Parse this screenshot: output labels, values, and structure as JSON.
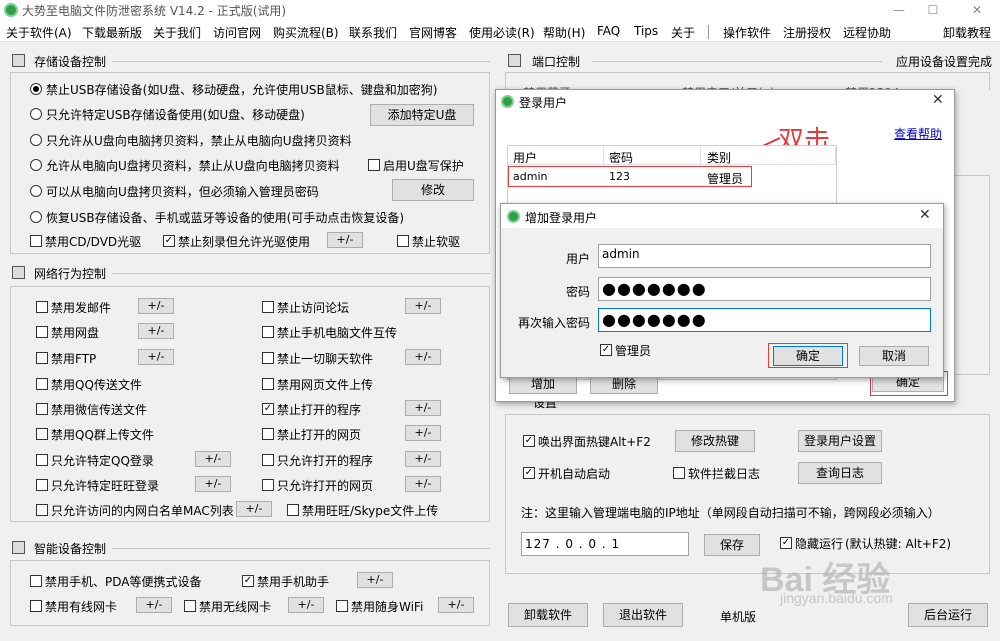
{
  "window": {
    "title": "大势至电脑文件防泄密系统 V14.2 - 正式版(试用)",
    "min": "—",
    "max": "☐",
    "close": "✕"
  },
  "menu": {
    "left": [
      "关于软件(A)",
      "下载最新版",
      "关于我们",
      "访问官网",
      "购买流程(B)",
      "联系我们",
      "官网博客",
      "使用必读(R)",
      "帮助(H)",
      "FAQ",
      "Tips",
      "关于"
    ],
    "right": [
      "操作软件",
      "注册授权",
      "远程协助"
    ],
    "far_right": "卸载教程"
  },
  "storage": {
    "title": "存储设备控制",
    "options": [
      "禁止USB存储设备(如U盘、移动硬盘，允许使用USB鼠标、键盘和加密狗)",
      "只允许特定USB存储设备使用(如U盘、移动硬盘)",
      "只允许从U盘向电脑拷贝资料，禁止从电脑向U盘拷贝资料",
      "允许从电脑向U盘拷贝资料，禁止从U盘向电脑拷贝资料",
      "可以从电脑向U盘拷贝资料，但必须输入管理员密码",
      "恢复USB存储设备、手机或蓝牙等设备的使用(可手动点击恢复设备)"
    ],
    "add_btn": "添加特定U盘",
    "write_protect": "启用U盘写保护",
    "modify_btn": "修改",
    "cd_disable": "禁用CD/DVD光驱",
    "cd_burn": "禁止刻录但允许光驱使用",
    "floppy": "禁止软驱",
    "pm": "+/-"
  },
  "network": {
    "title": "网络行为控制",
    "left": [
      "禁用发邮件",
      "禁用网盘",
      "禁用FTP",
      "禁用QQ传送文件",
      "禁用微信传送文件",
      "禁用QQ群上传文件",
      "只允许特定QQ登录",
      "只允许特定旺旺登录",
      "只允许访问的内网白名单MAC列表"
    ],
    "right": [
      "禁止访问论坛",
      "禁止手机电脑文件互传",
      "禁止一切聊天软件",
      "禁用网页文件上传",
      "禁止打开的程序",
      "禁止打开的网页",
      "只允许打开的程序",
      "只允许打开的网页",
      "禁用旺旺/Skype文件上传"
    ]
  },
  "smart": {
    "title": "智能设备控制",
    "items": [
      "禁用手机、PDA等便携式设备",
      "禁用手机助手",
      "禁用有线网卡",
      "禁用无线网卡",
      "禁用随身WiFi"
    ]
  },
  "port": {
    "title": "端口控制",
    "right_title": "应用设备设置完成",
    "hidden1": "禁用蓝牙",
    "hidden2": "禁用串口/并口(x)",
    "hidden3": "禁用1394"
  },
  "bottom_right": {
    "hotkey_cb": "唤出界面热键Alt+F2",
    "modify_hotkey": "修改热键",
    "login_user_settings": "登录用户设置",
    "autostart": "开机自动启动",
    "intercept_log": "软件拦截日志",
    "query_log": "查询日志",
    "note": "注：这里输入管理端电脑的IP地址（单网段自动扫描可不输，跨网段必须输入）",
    "ip": "127 . 0 . 0 . 1",
    "save": "保存",
    "hide_run": "隐藏运行",
    "hide_hint": "(默认热键: Alt+F2)",
    "hidden_section": "设置"
  },
  "footer": {
    "uninstall": "卸载软件",
    "exit": "退出软件",
    "mode": "单机版",
    "bg_run": "后台运行"
  },
  "login_dialog": {
    "title": "登录用户",
    "help": "查看帮助",
    "annotation": "双击",
    "columns": [
      "用户",
      "密码",
      "类别"
    ],
    "rows": [
      {
        "user": "admin",
        "password": "123",
        "category": "管理员"
      }
    ],
    "add": "增加",
    "delete": "删除",
    "ok": "确定"
  },
  "add_dialog": {
    "title": "增加登录用户",
    "user_label": "用户",
    "user_value": "admin",
    "pwd_label": "密码",
    "pwd_value": "●●●●●●●",
    "pwd2_label": "再次输入密码",
    "pwd2_value": "●●●●●●●",
    "admin_cb": "管理员",
    "ok": "确定",
    "cancel": "取消"
  },
  "watermark": {
    "brand": "Bai 经验",
    "url": "jingyan.baidu.com"
  }
}
